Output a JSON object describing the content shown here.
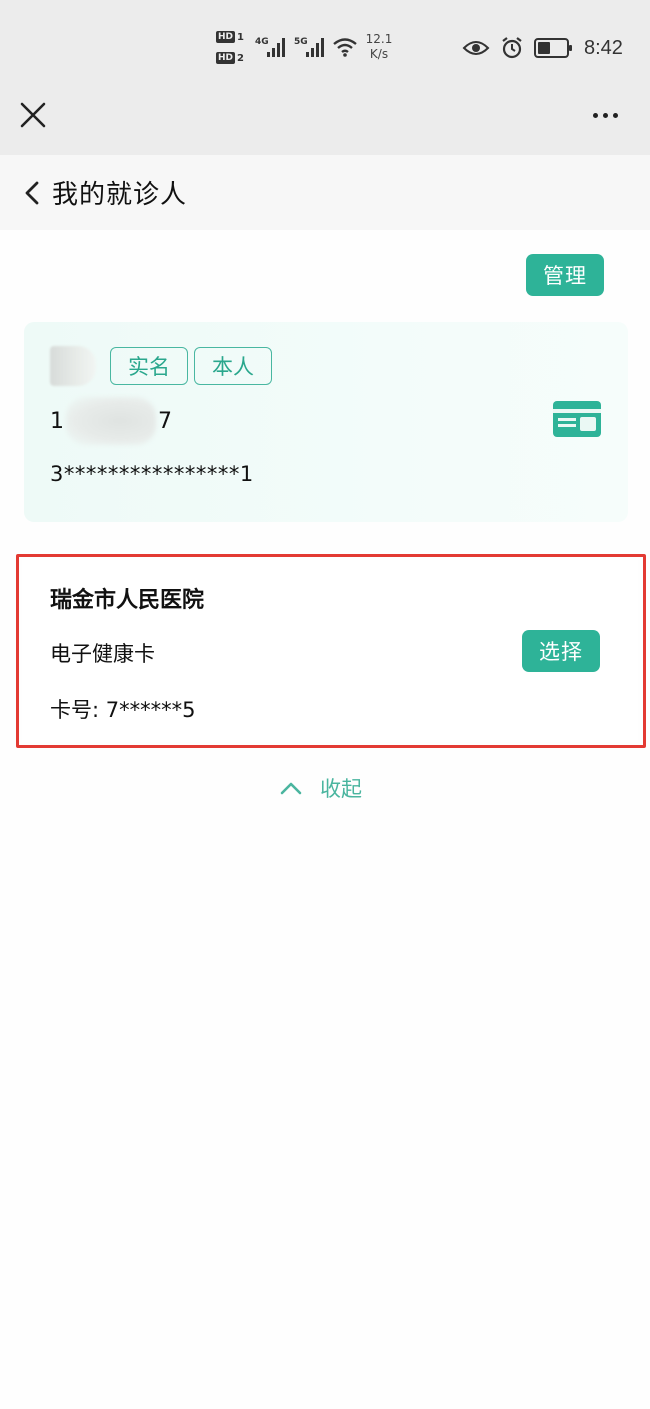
{
  "status_bar": {
    "hd1": "HD",
    "hd1_num": "1",
    "hd2": "HD",
    "hd2_num": "2",
    "net1": "4G",
    "net2": "5G",
    "speed_value": "12.1",
    "speed_unit": "K/s",
    "time": "8:42"
  },
  "header": {
    "title": "我的就诊人"
  },
  "actions": {
    "manage_label": "管理",
    "select_label": "选择",
    "collapse_label": "收起"
  },
  "patient": {
    "tags": [
      "实名",
      "本人"
    ],
    "phone_start": "1",
    "phone_end": "7",
    "id_number": "3****************1"
  },
  "hospital_card": {
    "hospital_name": "瑞金市人民医院",
    "card_type": "电子健康卡",
    "card_number": "卡号: 7******5"
  },
  "colors": {
    "accent": "#2eb398",
    "highlight": "#e33a33"
  }
}
